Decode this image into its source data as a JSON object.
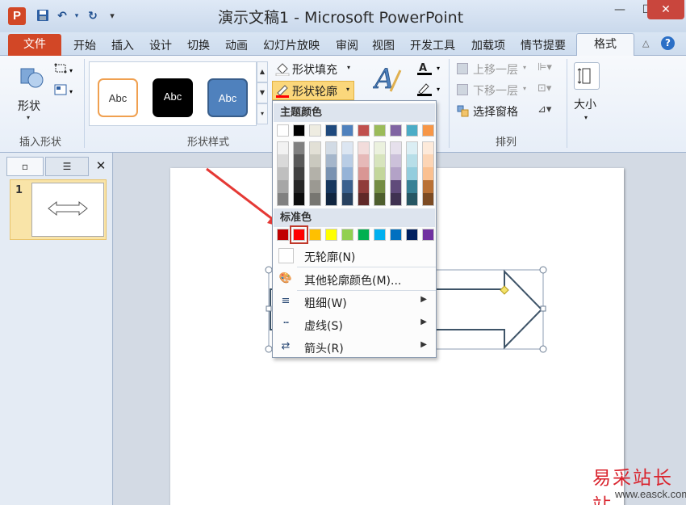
{
  "window": {
    "app_logo": "P",
    "title": "演示文稿1 - Microsoft PowerPoint",
    "controls": {
      "minimize": "—",
      "maximize": "☐",
      "close": "✕"
    }
  },
  "quick_access": {
    "save": "💾",
    "undo": "↶",
    "undo_dropdown": "▾",
    "redo": "↻",
    "customize": "₹"
  },
  "tabs": {
    "file": "文件",
    "items": [
      "开始",
      "插入",
      "设计",
      "切换",
      "动画",
      "幻灯片放映",
      "审阅",
      "视图",
      "开发工具",
      "加载项",
      "情节提要"
    ],
    "format": "格式",
    "collapse_icon": "ⓐ",
    "help_icon": "?"
  },
  "ribbon": {
    "insert_shape": {
      "shape_button": "形状",
      "group_label": "插入形状"
    },
    "shape_styles": {
      "gallery": [
        "Abc",
        "Abc",
        "Abc"
      ],
      "shape_fill": "形状填充",
      "shape_outline": "形状轮廓",
      "group_label": "形状样式"
    },
    "arrange": {
      "bring_forward": "上移一层",
      "send_backward": "下移一层",
      "selection_pane": "选择窗格",
      "group_label": "排列"
    },
    "size": {
      "label": "大小"
    }
  },
  "left_panel": {
    "slide_number": "1",
    "close": "✕"
  },
  "outline_menu": {
    "theme_colors_header": "主题颜色",
    "theme_colors": [
      "#ffffff",
      "#000000",
      "#eeece1",
      "#1f497d",
      "#4f81bd",
      "#c0504d",
      "#9bbb59",
      "#8064a2",
      "#4bacc6",
      "#f79646"
    ],
    "standard_colors_header": "标准色",
    "standard_colors": [
      "#c00000",
      "#ff0000",
      "#ffc000",
      "#ffff00",
      "#92d050",
      "#00b050",
      "#00b0f0",
      "#0070c0",
      "#002060",
      "#7030a0"
    ],
    "selected_standard_color": "#ff0000",
    "no_outline": "无轮廓(N)",
    "more_colors": "其他轮廓颜色(M)...",
    "weight": "粗细(W)",
    "dashes": "虚线(S)",
    "arrows": "箭头(R)"
  },
  "watermark": {
    "text": "易采站长站",
    "url": "www.easck.com"
  }
}
